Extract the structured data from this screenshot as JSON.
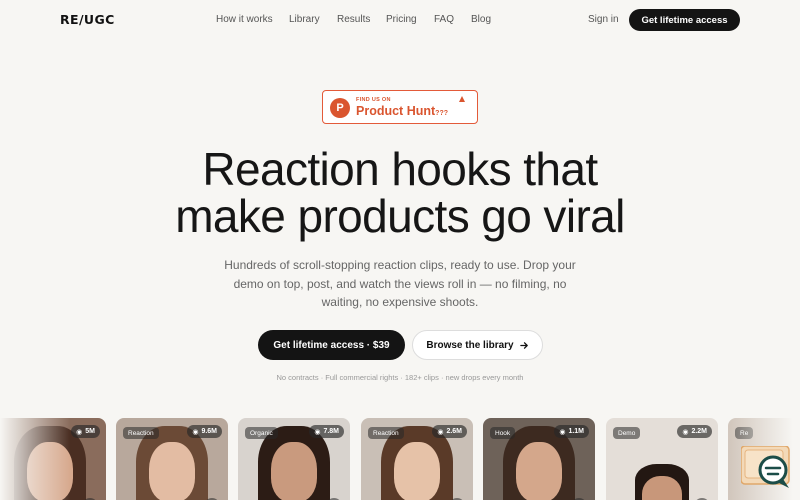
{
  "header": {
    "logo": "RE/UGC",
    "nav": [
      "How it works",
      "Library",
      "Results",
      "Pricing",
      "FAQ",
      "Blog"
    ],
    "sign_in": "Sign in",
    "cta": "Get lifetime access"
  },
  "badge": {
    "small": "FIND US ON",
    "big": "Product Hunt",
    "suffix": "???"
  },
  "hero": {
    "headline_line1": "Reaction hooks that",
    "headline_line2": "make products go viral",
    "subtext": "Hundreds of scroll-stopping reaction clips, ready to use. Drop your demo on top, post, and watch the views roll in — no filming, no waiting, no expensive shoots.",
    "primary_cta": "Get lifetime access · $39",
    "secondary_cta": "Browse the library",
    "fineprint": "No contracts · Full commercial rights · 182+ clips · new drops every month"
  },
  "clips": [
    {
      "tag": "",
      "views": "5M"
    },
    {
      "tag": "Reaction",
      "views": "9.6M"
    },
    {
      "tag": "Organic",
      "views": "7.8M"
    },
    {
      "tag": "Reaction",
      "views": "2.6M"
    },
    {
      "tag": "Hook",
      "views": "1.1M"
    },
    {
      "tag": "Demo",
      "views": "2.2M"
    },
    {
      "tag": "Re",
      "views": ""
    }
  ],
  "colors": {
    "accent_dark": "#141414",
    "product_hunt": "#da552f",
    "background": "#f7f6f3"
  }
}
